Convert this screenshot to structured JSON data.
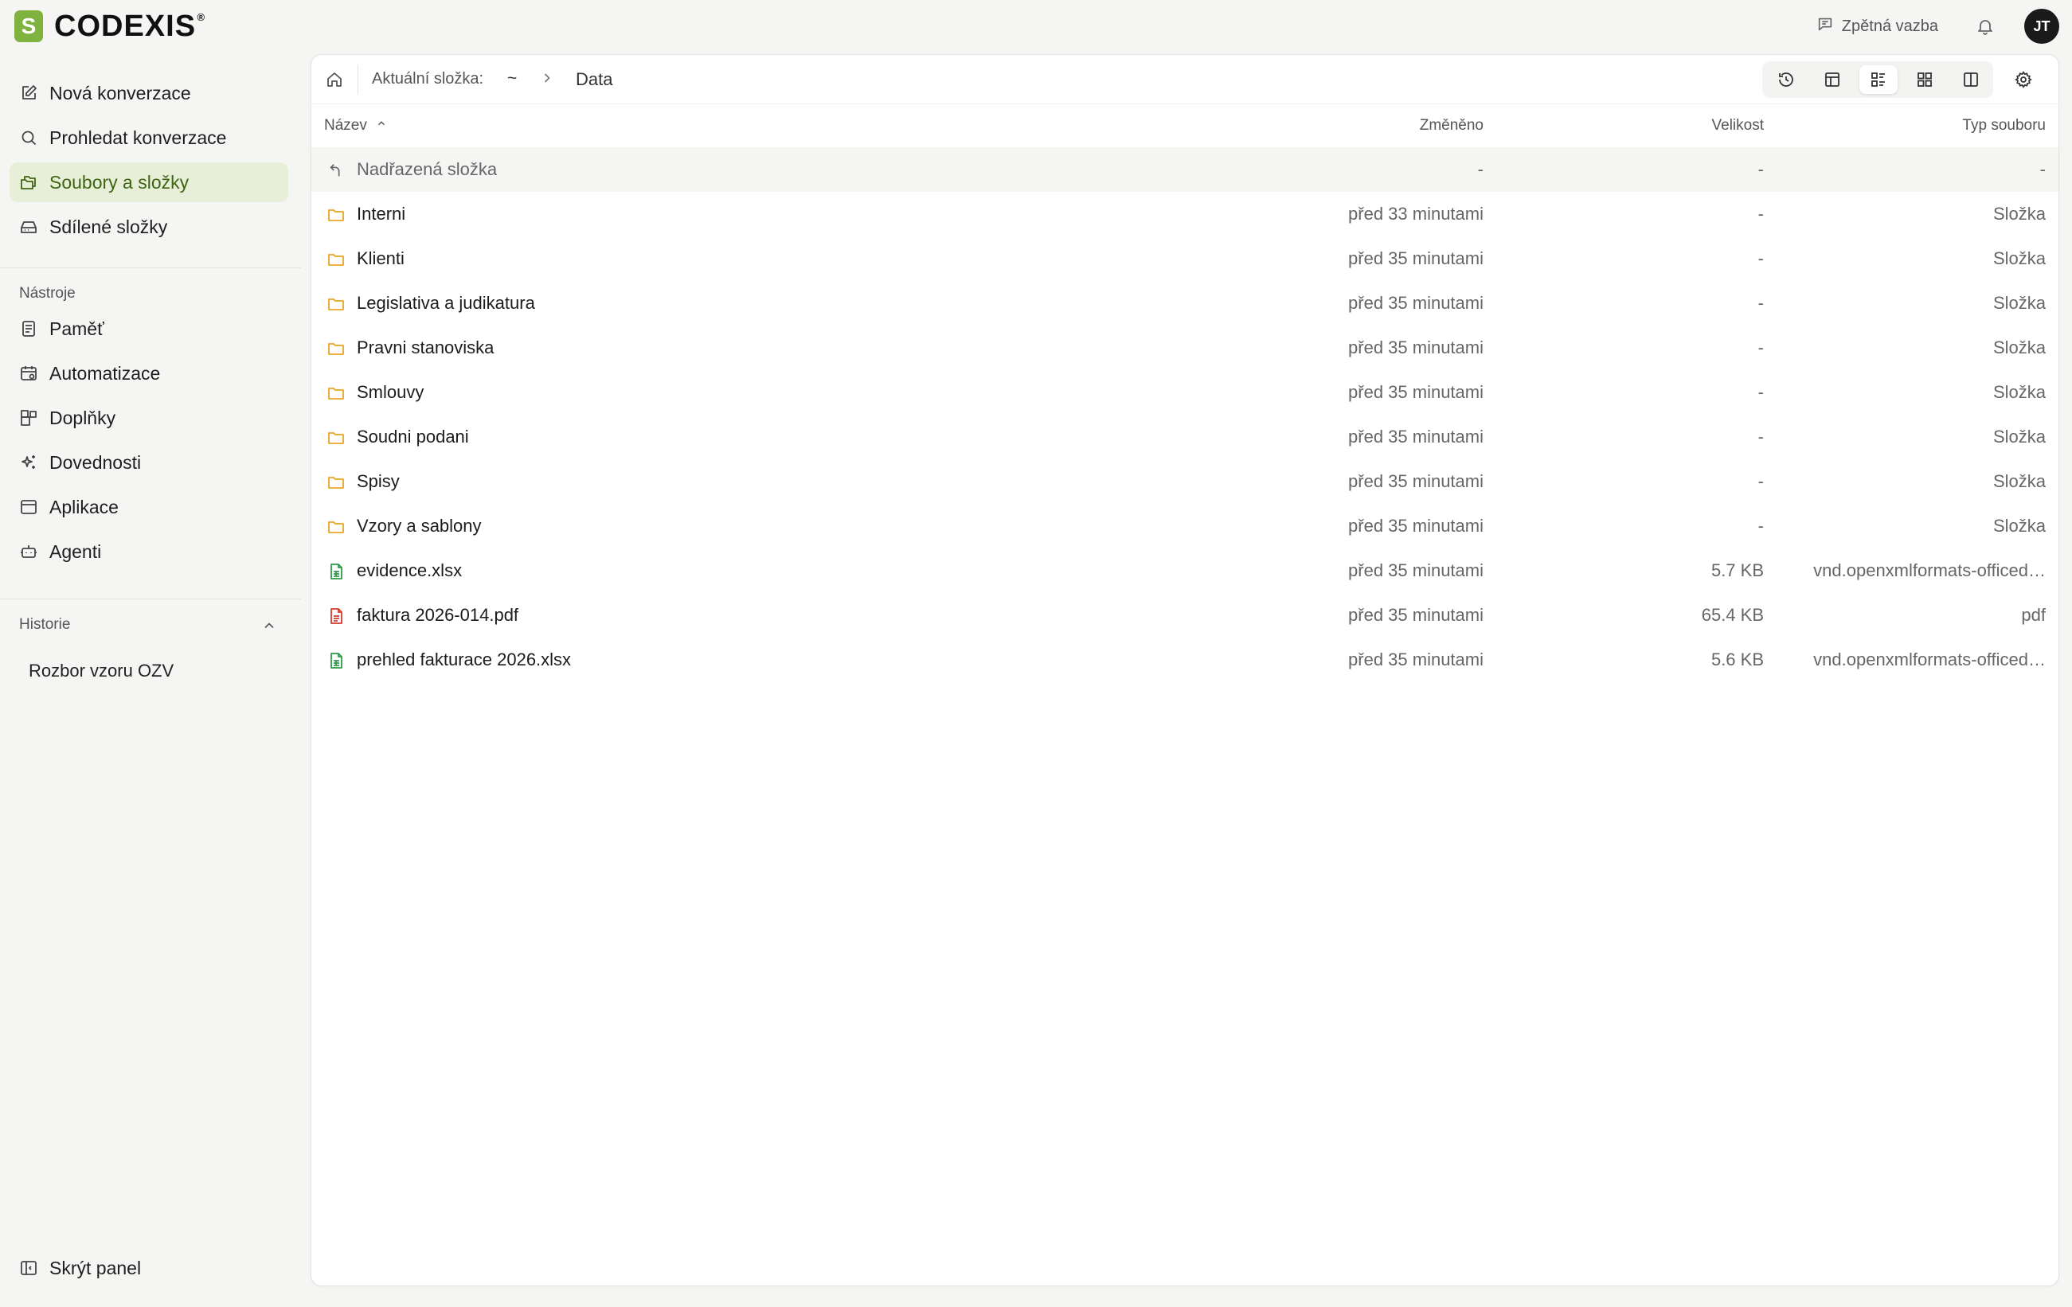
{
  "app": {
    "brand_name": "CODEXIS",
    "brand_mark": "S",
    "brand_symbol": "®",
    "accent_color": "#7fb23e"
  },
  "header": {
    "feedback_label": "Zpětná vazba",
    "user_initials": "JT"
  },
  "sidebar": {
    "primary": [
      {
        "label": "Nová konverzace",
        "icon": "edit-icon"
      },
      {
        "label": "Prohledat konverzace",
        "icon": "search-icon"
      },
      {
        "label": "Soubory a složky",
        "icon": "files-icon",
        "active": true
      },
      {
        "label": "Sdílené složky",
        "icon": "drive-icon"
      }
    ],
    "tools_title": "Nástroje",
    "tools": [
      {
        "label": "Paměť",
        "icon": "memory-icon"
      },
      {
        "label": "Automatizace",
        "icon": "calendar-automation-icon"
      },
      {
        "label": "Doplňky",
        "icon": "addons-icon"
      },
      {
        "label": "Dovednosti",
        "icon": "sparkles-icon"
      },
      {
        "label": "Aplikace",
        "icon": "app-window-icon"
      },
      {
        "label": "Agenti",
        "icon": "bot-icon"
      }
    ],
    "history_title": "Historie",
    "history": [
      {
        "label": "Rozbor vzoru OZV"
      }
    ],
    "hide_panel_label": "Skrýt panel"
  },
  "toolbar": {
    "current_folder_label": "Aktuální složka:",
    "breadcrumb_root": "~",
    "breadcrumb_current": "Data",
    "active_view": "detailed-list"
  },
  "table": {
    "columns": {
      "name": "Název",
      "modified": "Změněno",
      "size": "Velikost",
      "type": "Typ souboru"
    },
    "sort": {
      "column": "name",
      "direction": "asc"
    },
    "parent_row": {
      "name": "Nadřazená složka",
      "modified": "-",
      "size": "-",
      "type": "-"
    },
    "rows": [
      {
        "name": "Interni",
        "modified": "před 33 minutami",
        "size": "-",
        "type": "Složka",
        "kind": "folder"
      },
      {
        "name": "Klienti",
        "modified": "před 35 minutami",
        "size": "-",
        "type": "Složka",
        "kind": "folder"
      },
      {
        "name": "Legislativa a judikatura",
        "modified": "před 35 minutami",
        "size": "-",
        "type": "Složka",
        "kind": "folder"
      },
      {
        "name": "Pravni stanoviska",
        "modified": "před 35 minutami",
        "size": "-",
        "type": "Složka",
        "kind": "folder"
      },
      {
        "name": "Smlouvy",
        "modified": "před 35 minutami",
        "size": "-",
        "type": "Složka",
        "kind": "folder"
      },
      {
        "name": "Soudni podani",
        "modified": "před 35 minutami",
        "size": "-",
        "type": "Složka",
        "kind": "folder"
      },
      {
        "name": "Spisy",
        "modified": "před 35 minutami",
        "size": "-",
        "type": "Složka",
        "kind": "folder"
      },
      {
        "name": "Vzory a sablony",
        "modified": "před 35 minutami",
        "size": "-",
        "type": "Složka",
        "kind": "folder"
      },
      {
        "name": "evidence.xlsx",
        "modified": "před 35 minutami",
        "size": "5.7 KB",
        "type": "vnd.openxmlformats-officed…",
        "kind": "spreadsheet"
      },
      {
        "name": "faktura 2026-014.pdf",
        "modified": "před 35 minutami",
        "size": "65.4 KB",
        "type": "pdf",
        "kind": "pdf"
      },
      {
        "name": "prehled fakturace 2026.xlsx",
        "modified": "před 35 minutami",
        "size": "5.6 KB",
        "type": "vnd.openxmlformats-officed…",
        "kind": "spreadsheet"
      }
    ]
  },
  "colors": {
    "folder": "#e8a623",
    "spreadsheet": "#2f9a4a",
    "pdf": "#d63a2f",
    "active_nav_bg": "#e7efd9",
    "active_nav_text": "#3f6512"
  }
}
